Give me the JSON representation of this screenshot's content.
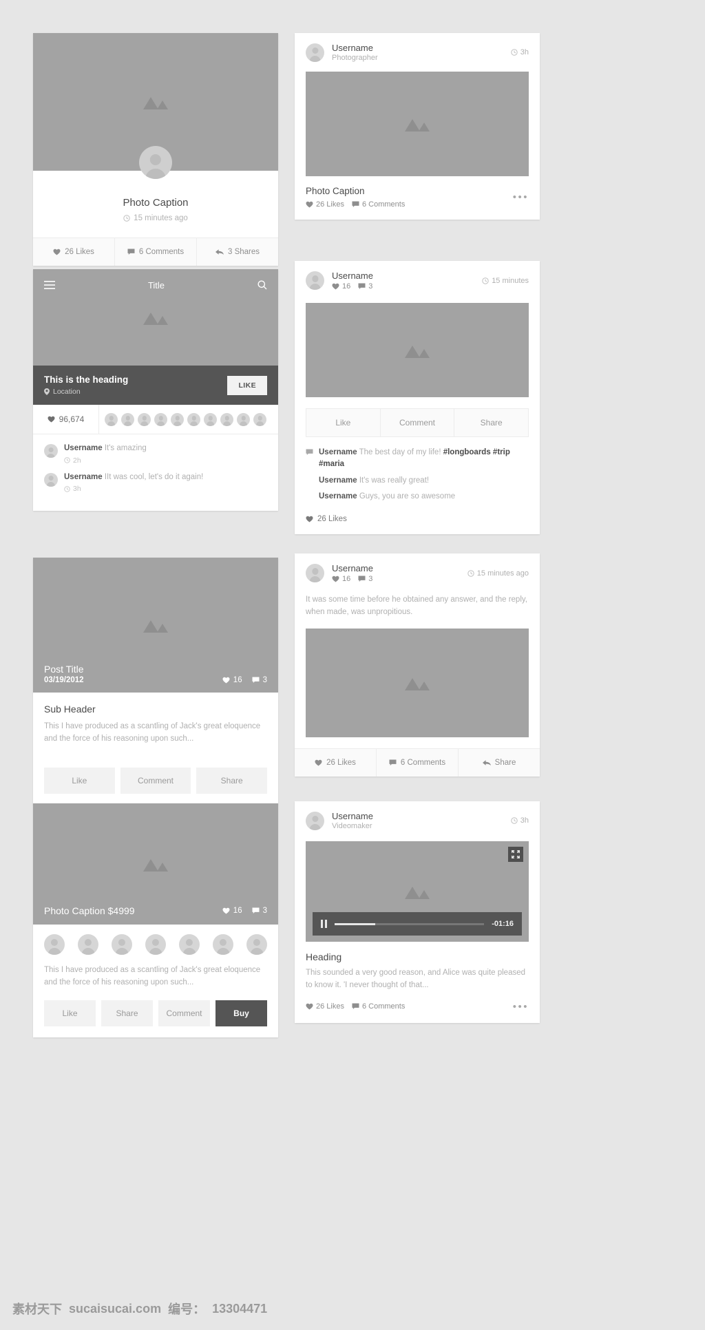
{
  "icons": {
    "heart": "heart-icon",
    "comment": "comment-icon",
    "share": "share-arrow-icon",
    "clock": "clock-icon",
    "pin": "location-pin-icon",
    "menu": "hamburger-menu-icon",
    "search": "search-icon",
    "more": "more-dots-icon",
    "fullscreen": "fullscreen-icon",
    "pause": "pause-icon",
    "image": "image-placeholder-icon",
    "avatar": "avatar-icon"
  },
  "colors": {
    "background": "#e6e6e6",
    "card": "#ffffff",
    "placeholder": "#a3a3a3",
    "dark_overlay": "#555555",
    "muted_text": "#b0b0b0",
    "heading_text": "#4a4a4a"
  },
  "left_column": {
    "card_photo_profile": {
      "caption": "Photo Caption",
      "timestamp": "15 minutes ago",
      "stats": [
        {
          "label": "26 Likes",
          "icon": "heart"
        },
        {
          "label": "6 Comments",
          "icon": "comment"
        },
        {
          "label": "3 Shares",
          "icon": "share"
        }
      ]
    },
    "card_hero_heading": {
      "app_title": "Title",
      "heading": "This is the heading",
      "location": "Location",
      "like_button": "LIKE",
      "like_count": "96,674",
      "avatar_count": 10,
      "comments": [
        {
          "user": "Username",
          "text": "It's amazing",
          "time": "2h"
        },
        {
          "user": "Username",
          "text": "IIt was cool, let's do it again!",
          "time": "3h"
        }
      ]
    },
    "card_post": {
      "title": "Post Title",
      "date": "03/19/2012",
      "likes": "16",
      "comments": "3",
      "sub_header": "Sub Header",
      "body": "This I have produced as a scantling of Jack's great eloquence and the force of his reasoning upon such...",
      "buttons": [
        "Like",
        "Comment",
        "Share"
      ]
    },
    "card_product": {
      "caption": "Photo Caption $4999",
      "likes": "16",
      "comments": "3",
      "avatar_count": 7,
      "body": "This I have produced as a scantling of Jack's great eloquence and the force of his reasoning upon such...",
      "buttons": [
        "Like",
        "Share",
        "Comment"
      ],
      "buy_button": "Buy"
    }
  },
  "right_column": {
    "card_photo": {
      "username": "Username",
      "role": "Photographer",
      "timestamp": "3h",
      "caption": "Photo Caption",
      "likes": "26 Likes",
      "comments": "6 Comments",
      "more": "•••"
    },
    "card_social": {
      "username": "Username",
      "likes": "16",
      "comments": "3",
      "timestamp": "15 minutes",
      "tabs": [
        "Like",
        "Comment",
        "Share"
      ],
      "comments_list": [
        {
          "user": "Username",
          "text": "The best day of my life! ",
          "tags": "#longboards #trip #maria"
        },
        {
          "user": "Username",
          "text": "It's was really great!",
          "tags": ""
        },
        {
          "user": "Username",
          "text": "Guys, you are so awesome",
          "tags": ""
        }
      ],
      "likes_label": "26 Likes"
    },
    "card_text_photo": {
      "username": "Username",
      "likes": "16",
      "comments": "3",
      "timestamp": "15 minutes ago",
      "body": "It was some time before he obtained any answer, and the reply, when made, was unpropitious.",
      "stats": [
        {
          "label": "26 Likes",
          "icon": "heart"
        },
        {
          "label": "6 Comments",
          "icon": "comment"
        },
        {
          "label": "Share",
          "icon": "share"
        }
      ]
    },
    "card_video": {
      "username": "Username",
      "role": "Videomaker",
      "timestamp": "3h",
      "time_remaining": "-01:16",
      "progress_percent": 27,
      "heading": "Heading",
      "body": "This sounded a very good reason, and Alice was quite pleased to know it. 'I never thought of that...",
      "likes": "26 Likes",
      "comments": "6 Comments",
      "more": "•••"
    }
  },
  "watermark": {
    "site_cn": "素材天下",
    "site": "sucaisucai.com",
    "id_label": "编号：",
    "id": "13304471"
  }
}
